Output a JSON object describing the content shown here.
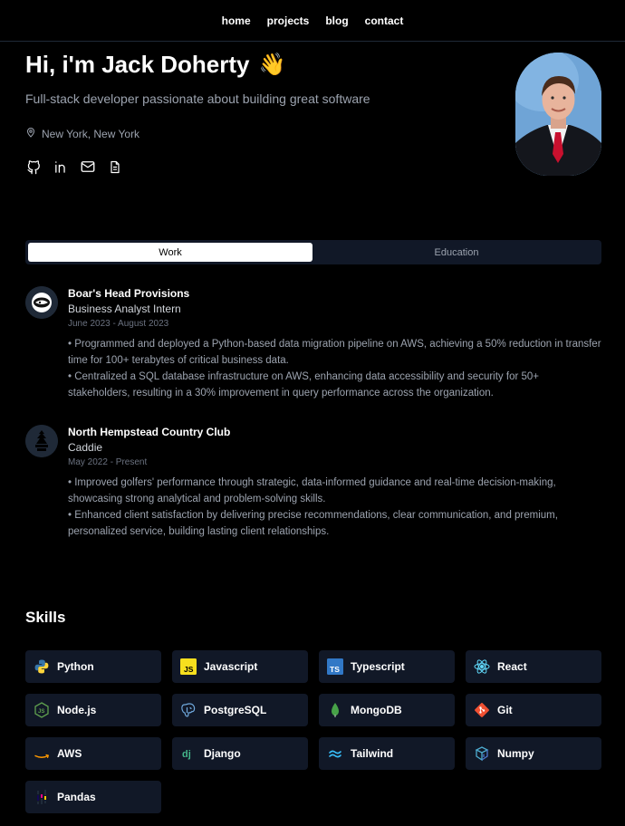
{
  "nav": {
    "items": [
      "home",
      "projects",
      "blog",
      "contact"
    ]
  },
  "hero": {
    "greeting": "Hi, i'm Jack Doherty",
    "wave": "👋",
    "subtitle": "Full-stack developer passionate about building great software",
    "location": "New York, New York"
  },
  "tabs": {
    "work": "Work",
    "education": "Education"
  },
  "jobs": [
    {
      "company": "Boar's Head Provisions",
      "role": "Business Analyst Intern",
      "dates": "June 2023 - August 2023",
      "bullets": [
        "•   Programmed and deployed a Python-based data migration pipeline on AWS, achieving a 50% reduction in transfer time for 100+ terabytes of critical business data.",
        "•   Centralized a SQL database infrastructure on AWS, enhancing data accessibility and security for 50+ stakeholders, resulting in a 30% improvement in query performance across the organization."
      ]
    },
    {
      "company": "North Hempstead Country Club",
      "role": "Caddie",
      "dates": "May 2022 - Present",
      "bullets": [
        "•   Improved golfers' performance through strategic, data-informed guidance and real-time decision-making, showcasing strong analytical and problem-solving skills.",
        "•   Enhanced client satisfaction by delivering precise recommendations, clear communication, and premium, personalized service, building lasting client relationships."
      ]
    }
  ],
  "skills": {
    "title": "Skills",
    "items": [
      "Python",
      "Javascript",
      "Typescript",
      "React",
      "Node.js",
      "PostgreSQL",
      "MongoDB",
      "Git",
      "AWS",
      "Django",
      "Tailwind",
      "Numpy",
      "Pandas"
    ]
  },
  "colors": {
    "background": "#000000",
    "card": "#111827",
    "muted": "#9ca3af"
  }
}
